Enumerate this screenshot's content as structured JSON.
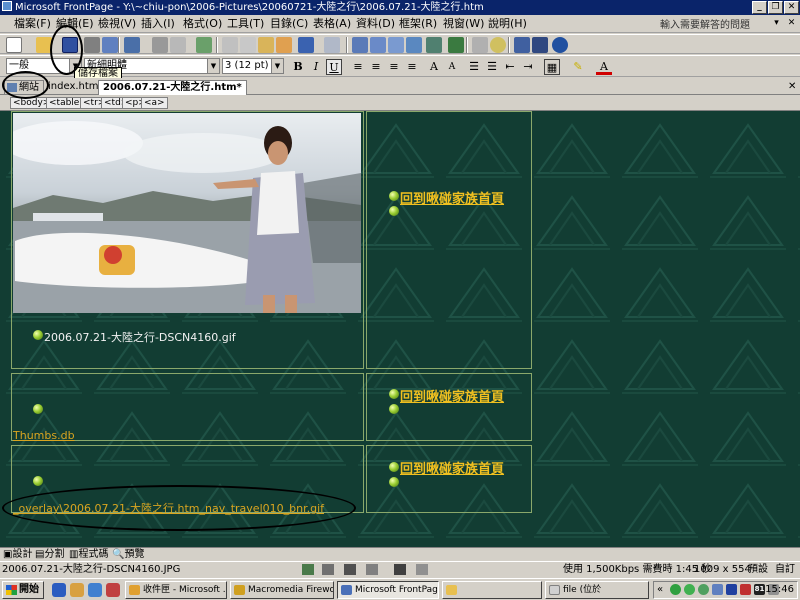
{
  "window": {
    "title": "Microsoft FrontPage - Y:\\~chiu-pon\\2006-Pictures\\20060721-大陸之行\\2006.07.21-大陸之行.htm",
    "controls": [
      "_",
      "❐",
      "✕"
    ]
  },
  "menu": {
    "items": [
      "檔案(F)",
      "編輯(E)",
      "檢視(V)",
      "插入(I)",
      "格式(O)",
      "工具(T)",
      "目錄(C)",
      "表格(A)",
      "資料(D)",
      "框架(R)",
      "視窗(W)",
      "說明(H)"
    ],
    "ask_placeholder": "輸入需要解答的問題",
    "doc_controls": [
      "▾",
      "✕"
    ]
  },
  "toolbar_format": {
    "style": "一般",
    "font": "新細明體",
    "size": "3  (12 pt)",
    "bold": "B",
    "italic": "I",
    "underline": "U"
  },
  "tooltip": "儲存檔案",
  "tabs": {
    "website": "網站",
    "tab1": "index.html",
    "tab2": "2006.07.21-大陸之行.htm*"
  },
  "tags": [
    "<body>",
    "<table>",
    "<tr>",
    "<td>",
    "<p>",
    "<a>"
  ],
  "page": {
    "home_link": "回到啾碰家族首頁",
    "image_caption": "2006.07.21-大陸之行-DSCN4160.gif",
    "thumbs_link": "Thumbs.db",
    "overlay_link": "_overlay\\2006.07.21-大陸之行.htm_nav_travel010_bnr.gif"
  },
  "views": {
    "design": "設計",
    "split": "分割",
    "code": "程式碼",
    "preview": "預覽"
  },
  "status": {
    "file": "2006.07.21-大陸之行-DSCN4160.JPG",
    "speed": "使用 1,500Kbps 需費時 1:45 秒",
    "dimensions": "1009 x 554",
    "mode1": "預設",
    "mode2": "自訂"
  },
  "taskbar": {
    "start": "開始",
    "tasks": [
      "收件匣 - Microsoft ...",
      "Macromedia Firewo...",
      "Microsoft FrontPage...",
      "",
      "file (位於"
    ],
    "clock": "15:46",
    "tray_badge": "81"
  },
  "colors": {
    "canvas_bg": "#123d33",
    "link_gold": "#f0c020",
    "cell_border": "#8aa86b",
    "titlebar": "#0a246a"
  }
}
